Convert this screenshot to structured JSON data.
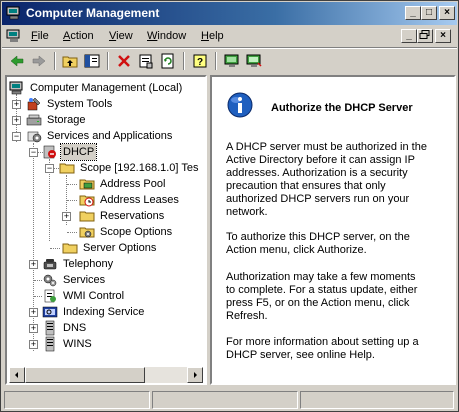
{
  "window": {
    "title": "Computer Management",
    "caption_buttons": {
      "minimize": "_",
      "maximize": "□",
      "close": "×"
    }
  },
  "menubar": {
    "items": [
      {
        "u": "F",
        "rest": "ile"
      },
      {
        "u": "A",
        "rest": "ction"
      },
      {
        "u": "V",
        "rest": "iew"
      },
      {
        "u": "W",
        "rest": "indow"
      },
      {
        "u": "H",
        "rest": "elp"
      }
    ]
  },
  "toolbar": {
    "icons": [
      "back-arrow-icon",
      "forward-arrow-icon",
      "up-folder-icon",
      "show-hide-tree-icon",
      "delete-icon",
      "properties-icon",
      "refresh-icon",
      "help-icon",
      "authorize-icon",
      "monitor-icon"
    ]
  },
  "tree": {
    "items": [
      {
        "label": "Computer Management (Local)",
        "icon": "computer-management-icon"
      },
      {
        "label": "System Tools",
        "icon": "system-tools-icon"
      },
      {
        "label": "Storage",
        "icon": "storage-icon"
      },
      {
        "label": "Services and Applications",
        "icon": "services-applications-icon"
      },
      {
        "label": "DHCP",
        "icon": "dhcp-server-icon"
      },
      {
        "label": "Scope [192.168.1.0] Tes",
        "icon": "folder-icon"
      },
      {
        "label": "Address Pool",
        "icon": "address-pool-icon"
      },
      {
        "label": "Address Leases",
        "icon": "address-leases-icon"
      },
      {
        "label": "Reservations",
        "icon": "folder-icon"
      },
      {
        "label": "Scope Options",
        "icon": "scope-options-icon"
      },
      {
        "label": "Server Options",
        "icon": "folder-icon"
      },
      {
        "label": "Telephony",
        "icon": "telephony-icon"
      },
      {
        "label": "Services",
        "icon": "services-icon"
      },
      {
        "label": "WMI Control",
        "icon": "wmi-control-icon"
      },
      {
        "label": "Indexing Service",
        "icon": "indexing-service-icon"
      },
      {
        "label": "DNS",
        "icon": "dns-icon"
      },
      {
        "label": "WINS",
        "icon": "wins-icon"
      }
    ]
  },
  "detail": {
    "title": "Authorize the DHCP Server",
    "icon": "info-icon",
    "paragraphs": [
      [
        "A DHCP server must be authorized in the",
        "Active Directory before it can assign IP",
        "addresses. Authorization is a security",
        "precaution that ensures that only",
        "authorized DHCP servers run on your",
        "network."
      ],
      [
        "To authorize this DHCP server, on the",
        "Action menu, click Authorize."
      ],
      [
        "Authorization may take a few moments",
        "to complete. For a status update, either",
        "press F5, or on the Action menu, click",
        "Refresh."
      ],
      [
        "For more information about setting up a",
        "DHCP server, see online Help."
      ]
    ]
  },
  "colors": {
    "title_start": "#0a246a",
    "title_end": "#a6caf0",
    "face": "#d4d0c8",
    "info_blue": "#1f5fbf"
  }
}
